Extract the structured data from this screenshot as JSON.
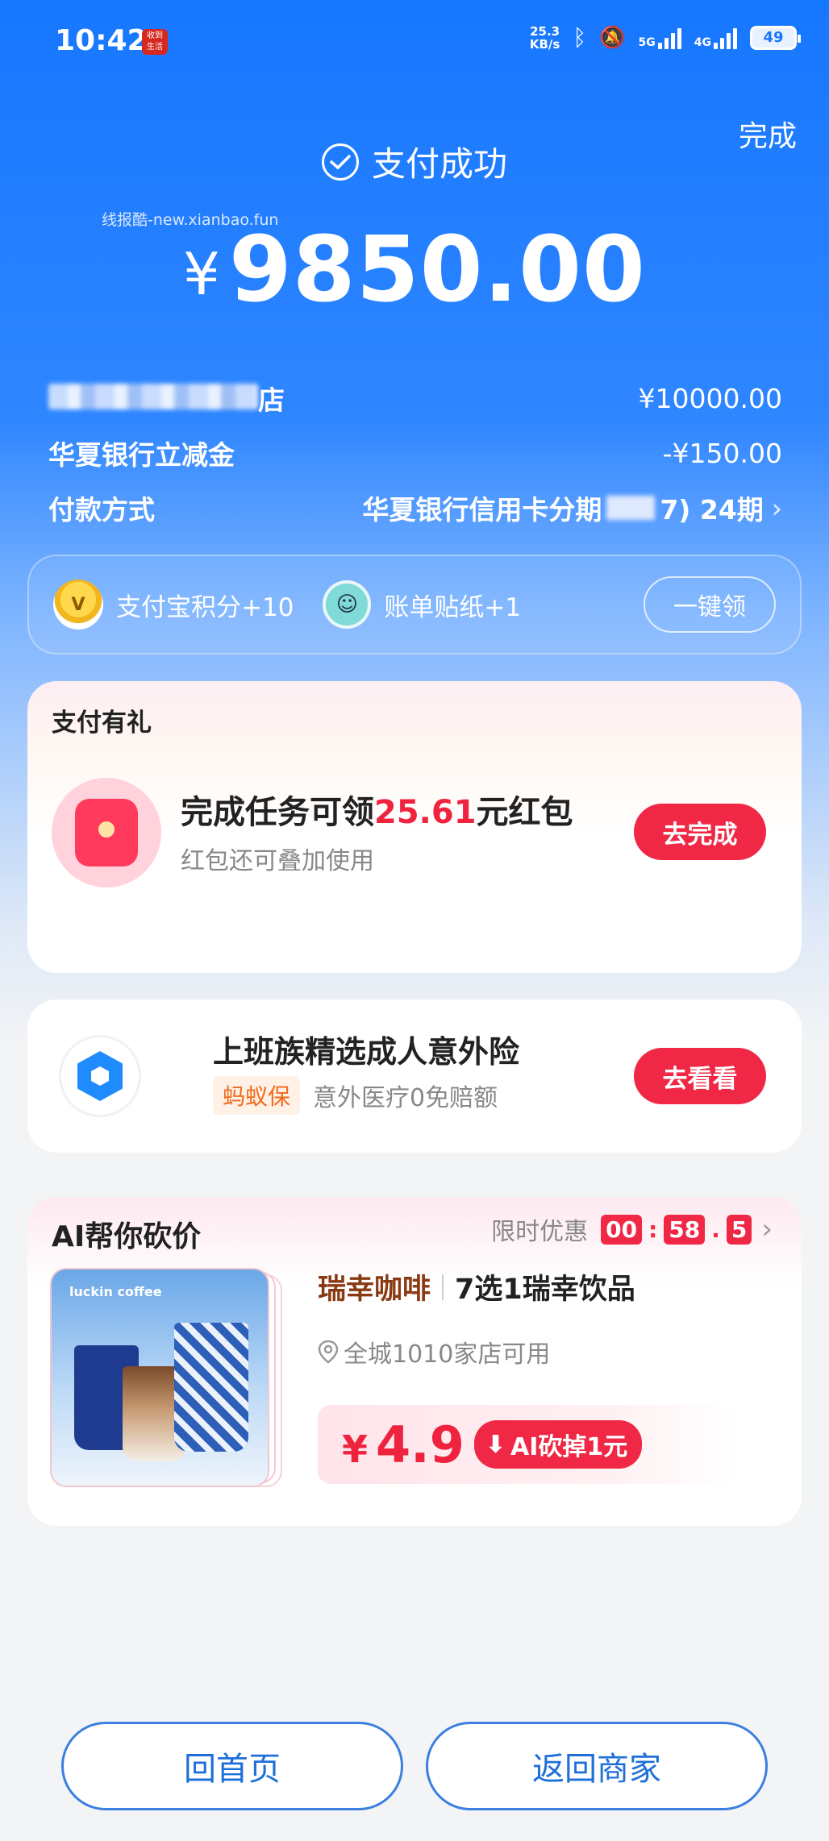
{
  "status_bar": {
    "time": "10:42",
    "app_icon_text": "收到\n生活",
    "net_speed_value": "25.3",
    "net_speed_unit": "KB/s",
    "signal_1": "5G",
    "signal_2": "4G",
    "battery": "49"
  },
  "header": {
    "done_label": "完成",
    "success_text": "支付成功",
    "watermark": "线报酷-new.xianbao.fun",
    "amount_symbol": "¥",
    "amount": "9850.00"
  },
  "details": {
    "merchant_suffix": "店",
    "merchant_amount": "¥10000.00",
    "discount_label": "华夏银行立减金",
    "discount_amount": "-¥150.00",
    "payment_label": "付款方式",
    "payment_value_prefix": "华夏银行信用卡分期",
    "payment_value_suffix": "7) 24期"
  },
  "rewards": {
    "points_label": "支付宝积分+10",
    "sticker_label": "账单贴纸+1",
    "claim_label": "一键领"
  },
  "gift_card": {
    "title": "支付有礼",
    "main_prefix": "完成任务可领",
    "main_amount": "25.61",
    "main_suffix": "元红包",
    "sub": "红包还可叠加使用",
    "button": "去完成"
  },
  "insurance_card": {
    "title": "上班族精选成人意外险",
    "tag": "蚂蚁保",
    "desc": "意外医疗0免赔额",
    "button": "去看看"
  },
  "ai_card": {
    "title": "AI帮你砍价",
    "limited_label": "限时优惠",
    "timer": {
      "mm": "00",
      "ss": "58",
      "ms": "5"
    },
    "brand_on_image": "luckin coffee",
    "brand": "瑞幸咖啡",
    "product": "7选1瑞幸饮品",
    "location": "全城1010家店可用",
    "price_symbol": "¥",
    "price": "4.9",
    "ai_cut_label": "AI砍掉1元"
  },
  "bottom": {
    "home_label": "回首页",
    "merchant_label": "返回商家"
  },
  "colors": {
    "brand_blue": "#1677ff",
    "accent_red": "#f02845",
    "text_gray": "#888888"
  }
}
